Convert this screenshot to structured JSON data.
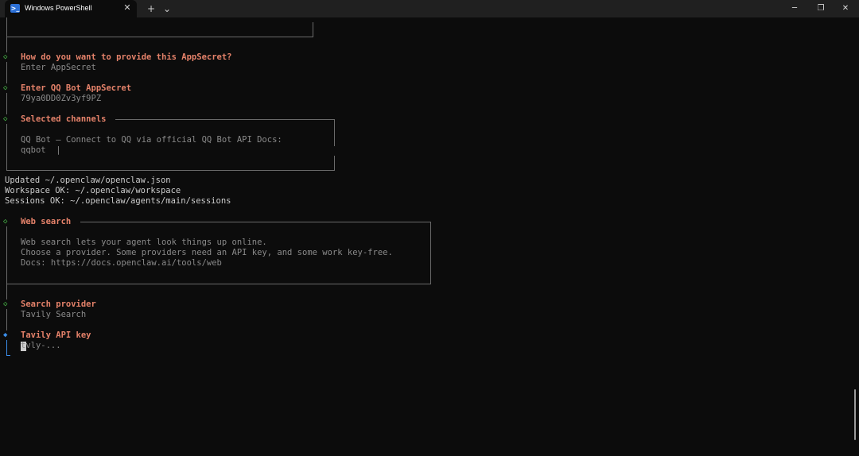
{
  "window": {
    "tab_title": "Windows PowerShell",
    "tab_icon": "powershell-icon",
    "new_tab_symbol": "+",
    "dropdown_symbol": "⌄",
    "tab_close_symbol": "✕",
    "minimize_symbol": "─",
    "maximize_symbol": "❐",
    "close_symbol": "✕"
  },
  "terminal": {
    "appsecret_prompt": {
      "question": "How do you want to provide this AppSecret?",
      "answer": "Enter AppSecret"
    },
    "appsecret_input": {
      "question": "Enter QQ Bot AppSecret",
      "answer": "79ya0DD0Zv3yf9PZ"
    },
    "channels_box": {
      "title": "Selected channels",
      "lines": [
        "QQ Bot — Connect to QQ via official QQ Bot API Docs:",
        "qqbot  |"
      ]
    },
    "log_lines": [
      "Updated ~/.openclaw/openclaw.json",
      "Workspace OK: ~/.openclaw/workspace",
      "Sessions OK: ~/.openclaw/agents/main/sessions"
    ],
    "web_search_box": {
      "title": "Web search",
      "lines": [
        "Web search lets your agent look things up online.",
        "Choose a provider. Some providers need an API key, and some work key-free.",
        "Docs: https://docs.openclaw.ai/tools/web"
      ]
    },
    "search_provider": {
      "question": "Search provider",
      "answer": "Tavily Search"
    },
    "api_key_prompt": {
      "question": "Tavily API key",
      "placeholder": "tvly-..."
    }
  },
  "colors": {
    "background": "#0c0c0c",
    "prompt": "#e5826a",
    "dim": "#8a8a8a",
    "text": "#cccccc",
    "done_marker": "#4ec94e",
    "active_marker": "#3b8eea"
  }
}
